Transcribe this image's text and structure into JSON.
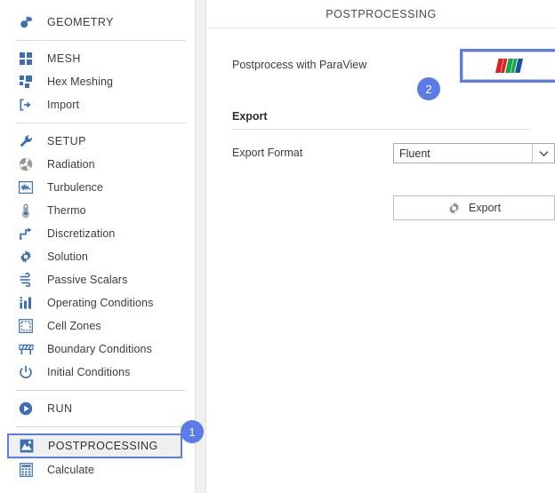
{
  "colors": {
    "accent": "#5b7ce8",
    "icon_blue": "#3c6eb4",
    "icon_gray": "#8a8a8a",
    "paraview_red": "#e02020",
    "paraview_green": "#14a64a",
    "paraview_blue": "#1b4f9c",
    "selection_bg": "#f0f0f0",
    "divider": "#d9d9d9"
  },
  "sidebar": {
    "groups": [
      {
        "items": [
          {
            "label": "GEOMETRY",
            "icon": "geometry-icon",
            "section": true,
            "selected": false
          }
        ]
      },
      {
        "items": [
          {
            "label": "MESH",
            "icon": "mesh-grid-icon",
            "section": true,
            "selected": false
          },
          {
            "label": "Hex Meshing",
            "icon": "hex-meshing-icon",
            "section": false,
            "selected": false
          },
          {
            "label": "Import",
            "icon": "import-arrow-icon",
            "section": false,
            "selected": false
          }
        ]
      },
      {
        "items": [
          {
            "label": "SETUP",
            "icon": "wrench-icon",
            "section": true,
            "selected": false
          },
          {
            "label": "Radiation",
            "icon": "radiation-icon",
            "section": false,
            "selected": false
          },
          {
            "label": "Turbulence",
            "icon": "turbulence-waveform-icon",
            "section": false,
            "selected": false
          },
          {
            "label": "Thermo",
            "icon": "thermometer-icon",
            "section": false,
            "selected": false
          },
          {
            "label": "Discretization",
            "icon": "discretization-steps-icon",
            "section": false,
            "selected": false
          },
          {
            "label": "Solution",
            "icon": "gear-icon",
            "section": false,
            "selected": false
          },
          {
            "label": "Passive Scalars",
            "icon": "wind-icon",
            "section": false,
            "selected": false
          },
          {
            "label": "Operating Conditions",
            "icon": "bar-chart-icon",
            "section": false,
            "selected": false
          },
          {
            "label": "Cell Zones",
            "icon": "dashed-square-icon",
            "section": false,
            "selected": false
          },
          {
            "label": "Boundary Conditions",
            "icon": "barrier-icon",
            "section": false,
            "selected": false
          },
          {
            "label": "Initial Conditions",
            "icon": "power-icon",
            "section": false,
            "selected": false
          }
        ]
      },
      {
        "items": [
          {
            "label": "RUN",
            "icon": "play-circle-icon",
            "section": true,
            "selected": false
          }
        ]
      },
      {
        "items": [
          {
            "label": "POSTPROCESSING",
            "icon": "image-mountain-icon",
            "section": true,
            "selected": true
          },
          {
            "label": "Calculate",
            "icon": "calculator-icon",
            "section": false,
            "selected": false
          }
        ]
      }
    ]
  },
  "main": {
    "title": "POSTPROCESSING",
    "paraview": {
      "label": "Postprocess with ParaView",
      "button_icon": "paraview-logo-icon"
    },
    "export": {
      "heading": "Export",
      "format_label": "Export Format",
      "format_value": "Fluent",
      "format_options": [
        "Fluent"
      ],
      "dropdown_icon": "chevron-down-icon",
      "button_label": "Export",
      "button_icon": "gear-icon"
    }
  },
  "badges": [
    {
      "number": "1"
    },
    {
      "number": "2"
    }
  ]
}
